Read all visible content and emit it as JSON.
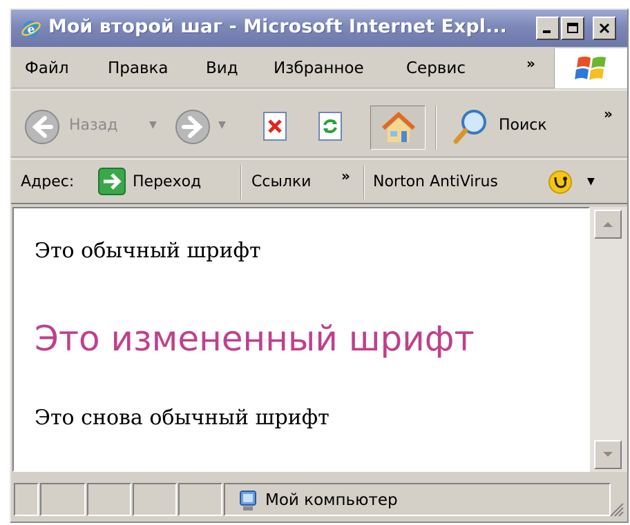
{
  "window": {
    "title": "Мой второй шаг - Microsoft Internet Expl..."
  },
  "menu": {
    "items": [
      "Файл",
      "Правка",
      "Вид",
      "Избранное",
      "Сервис"
    ],
    "more": "»"
  },
  "toolbar": {
    "back_label": "Назад",
    "search_label": "Поиск",
    "more": "»"
  },
  "address": {
    "label": "Адрес:",
    "go_label": "Переход",
    "links_label": "Ссылки",
    "links_more": "»",
    "norton_label": "Norton AntiVirus"
  },
  "content": {
    "line1": "Это обычный шрифт",
    "line2": "Это измененный шрифт",
    "line3": "Это снова обычный шрифт",
    "accent_color": "#c0408c"
  },
  "status": {
    "zone_text": "Мой компьютер"
  },
  "colors": {
    "titlebar": "#7d88b8",
    "chrome": "#d4d0c8"
  }
}
